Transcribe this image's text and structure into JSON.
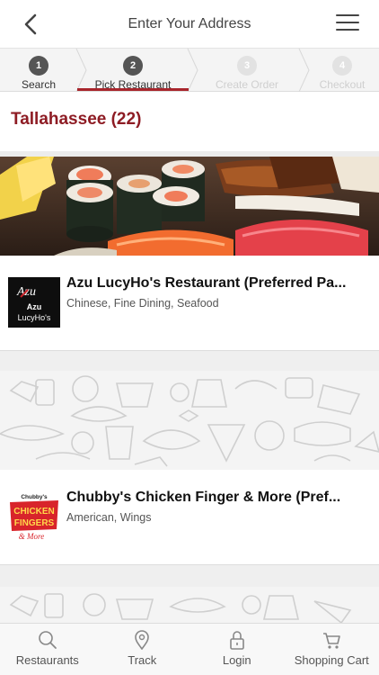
{
  "header": {
    "title": "Enter Your Address"
  },
  "steps": [
    {
      "num": "1",
      "label": "Search",
      "state": "active"
    },
    {
      "num": "2",
      "label": "Pick Restaurant",
      "state": "active"
    },
    {
      "num": "3",
      "label": "Create Order",
      "state": "inactive"
    },
    {
      "num": "4",
      "label": "Checkout",
      "state": "inactive"
    }
  ],
  "city_heading": "Tallahassee (22)",
  "restaurants": [
    {
      "name": "Azu LucyHo's Restaurant (Preferred Pa...",
      "categories": "Chinese, Fine Dining, Seafood",
      "logo_lines": [
        "Azu",
        "Azu",
        "LucyHo's"
      ]
    },
    {
      "name": "Chubby's Chicken Finger & More (Pref...",
      "categories": "American, Wings",
      "logo_lines": [
        "Chubby's",
        "CHICKEN",
        "FINGERS",
        "& More"
      ]
    }
  ],
  "bottom_nav": [
    {
      "label": "Restaurants",
      "icon": "search-icon"
    },
    {
      "label": "Track",
      "icon": "location-pin-icon"
    },
    {
      "label": "Login",
      "icon": "lock-icon"
    },
    {
      "label": "Shopping Cart",
      "icon": "cart-icon"
    }
  ],
  "colors": {
    "accent": "#8e1c24",
    "underline": "#a8252c"
  }
}
